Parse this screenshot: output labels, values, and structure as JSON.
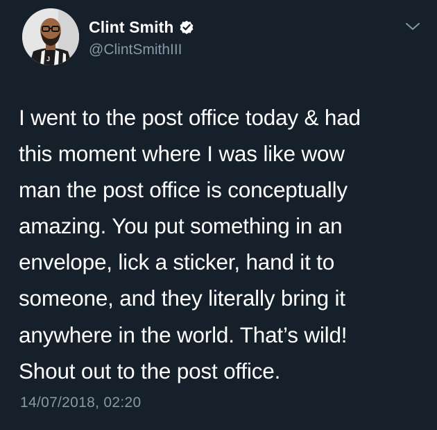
{
  "user": {
    "display_name": "Clint Smith",
    "handle": "@ClintSmithIII",
    "verified": true,
    "avatar_icon": "profile-photo"
  },
  "menu": {
    "icon": "chevron-down-icon"
  },
  "tweet": {
    "lines": [
      "I went to the post office today & had",
      "this moment where I was like wow",
      "man the post office is conceptually",
      "amazing. You put something in an",
      "envelope, lick a sticker, hand it to",
      "someone, and they literally bring it",
      "anywhere in the world. That’s wild!",
      "Shout out to the post office."
    ],
    "timestamp": "14/07/2018, 02:20"
  },
  "colors": {
    "background": "#15202b",
    "text": "#ffffff",
    "secondary": "#8899a6",
    "verified_badge": "#ffffff"
  }
}
